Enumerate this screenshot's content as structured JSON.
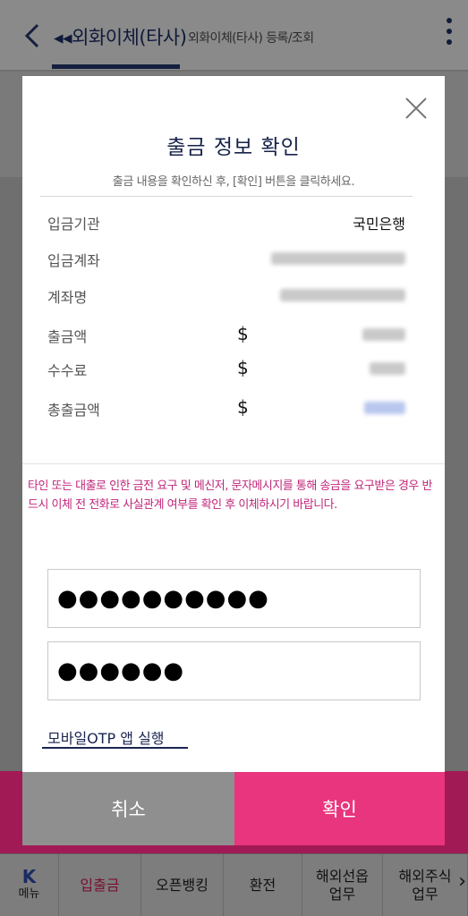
{
  "header": {
    "title": "외화이체(타사)",
    "subtitle": "외화이체(타사) 등록/조회"
  },
  "modal": {
    "title": "출금 정보 확인",
    "subtitle": "출금 내용을 확인하신 후, [확인] 버튼을 클릭하세요.",
    "rows": [
      {
        "label": "입금기관",
        "value": "국민은행",
        "currency": ""
      },
      {
        "label": "입금계좌",
        "value": "",
        "currency": ""
      },
      {
        "label": "계좌명",
        "value": "",
        "currency": ""
      },
      {
        "label": "출금액",
        "value": "",
        "currency": "$"
      },
      {
        "label": "수수료",
        "value": "",
        "currency": "$"
      },
      {
        "label": "총출금액",
        "value": "",
        "currency": "$"
      }
    ],
    "warning": "타인 또는 대출로 인한 금전 요구 및 메신저, 문자메시지를 통해 송금을 요구받은 경우 반드시 이체 전 전화로 사실관계 여부를 확인 후 이체하시기 바랍니다.",
    "password_value": "●●●●●●●●●●",
    "otp_value": "●●●●●●",
    "otp_link": "모바일OTP 앱 실행",
    "cancel_label": "취소",
    "confirm_label": "확인"
  },
  "tabbar": {
    "logo": "K",
    "menu": "메뉴",
    "tabs": [
      "입출금",
      "오픈뱅킹",
      "환전",
      "해외선옵\n업무",
      "해외주식\n업무"
    ]
  },
  "colors": {
    "accent": "#e8357d",
    "warning": "#c0267a",
    "navy": "#16224a"
  }
}
